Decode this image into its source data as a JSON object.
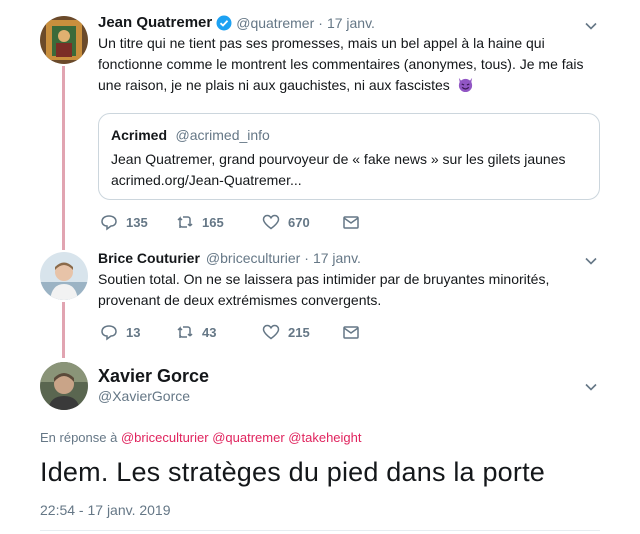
{
  "colors": {
    "thread_line": "#e1a4b1",
    "link": "#e0245e",
    "muted": "#657786",
    "verified": "#1da1f2"
  },
  "tweets": [
    {
      "name": "Jean Quatremer",
      "handle": "@quatremer",
      "sep": "·",
      "date": "17 janv.",
      "verified": true,
      "text_lines": [
        "Un titre qui ne tient pas ses promesses, mais un bel appel à la haine qui",
        "fonctionne comme le montrent les commentaires (anonymes, tous). Je me fais",
        "une raison, je ne plais ni aux gauchistes, ni aux fascistes"
      ],
      "emoji_icon": "smiling-devil-emoji",
      "quote": {
        "name": "Acrimed",
        "handle": "@acrimed_info",
        "text": "Jean Quatremer, grand pourvoyeur de « fake news » sur les gilets jaunes",
        "link": "acrimed.org/Jean-Quatremer..."
      },
      "replies": "135",
      "retweets": "165",
      "likes": "670"
    },
    {
      "name": "Brice Couturier",
      "handle": "@briceculturier",
      "sep": "·",
      "date": "17 janv.",
      "text_lines": [
        "Soutien total. On ne se laissera pas intimider par de bruyantes minorités,",
        "provenant de deux extrémismes convergents."
      ],
      "replies": "13",
      "retweets": "43",
      "likes": "215"
    }
  ],
  "main": {
    "name": "Xavier Gorce",
    "handle": "@XavierGorce",
    "reply_prefix": "En réponse à",
    "reply_to": [
      "@briceculturier",
      "@quatremer",
      "@takeheight"
    ],
    "text": "Idem. Les stratèges du pied dans la porte",
    "timestamp": "22:54 - 17 janv. 2019"
  }
}
